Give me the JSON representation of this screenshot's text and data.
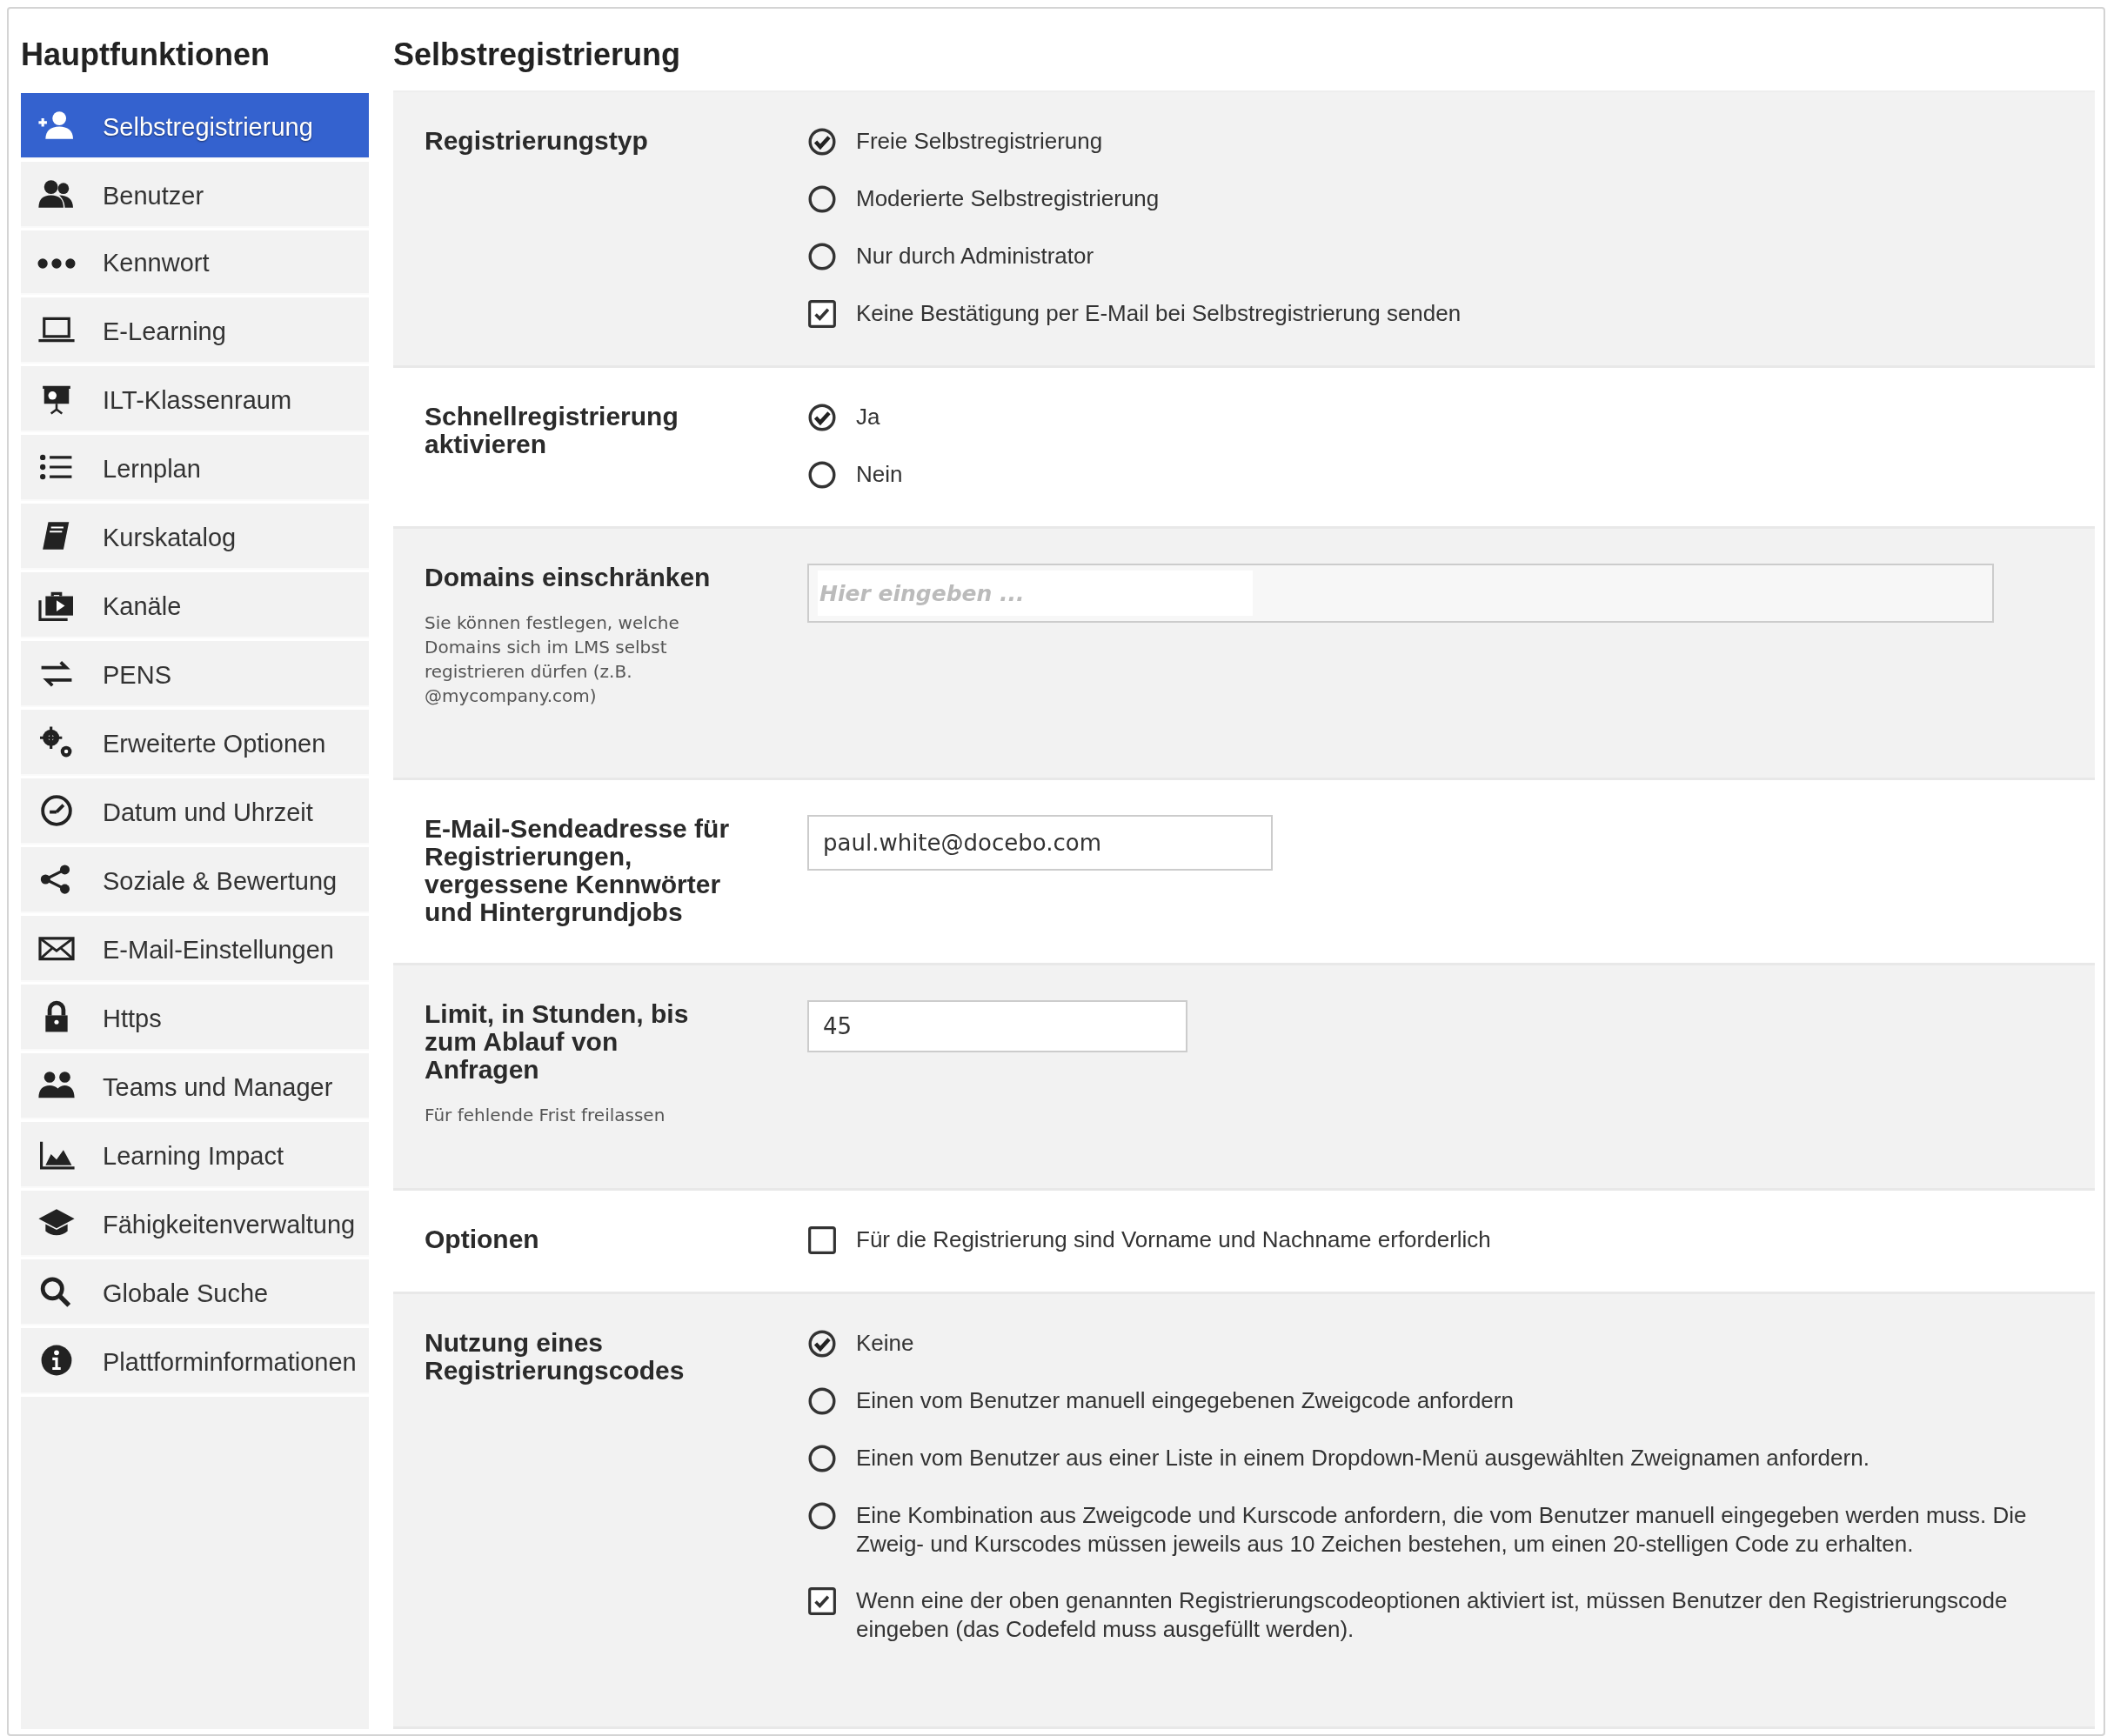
{
  "sidebar": {
    "title": "Hauptfunktionen",
    "items": [
      {
        "label": "Selbstregistrierung",
        "selected": true
      },
      {
        "label": "Benutzer",
        "selected": false
      },
      {
        "label": "Kennwort",
        "selected": false
      },
      {
        "label": "E-Learning",
        "selected": false
      },
      {
        "label": "ILT-Klassenraum",
        "selected": false
      },
      {
        "label": "Lernplan",
        "selected": false
      },
      {
        "label": "Kurskatalog",
        "selected": false
      },
      {
        "label": "Kanäle",
        "selected": false
      },
      {
        "label": "PENS",
        "selected": false
      },
      {
        "label": "Erweiterte Optionen",
        "selected": false
      },
      {
        "label": "Datum und Uhrzeit",
        "selected": false
      },
      {
        "label": "Soziale & Bewertung",
        "selected": false
      },
      {
        "label": "E-Mail-Einstellungen",
        "selected": false
      },
      {
        "label": "Https",
        "selected": false
      },
      {
        "label": "Teams und Manager",
        "selected": false
      },
      {
        "label": "Learning Impact",
        "selected": false
      },
      {
        "label": "Fähigkeitenverwaltung",
        "selected": false
      },
      {
        "label": "Globale Suche",
        "selected": false
      },
      {
        "label": "Plattforminformationen",
        "selected": false
      }
    ]
  },
  "page": {
    "title": "Selbstregistrierung",
    "sections": [
      {
        "label": "Registrierungstyp",
        "controls": [
          {
            "kind": "radio",
            "label": "Freie Selbstregistrierung",
            "selected": true
          },
          {
            "kind": "radio",
            "label": "Moderierte Selbstregistrierung",
            "selected": false
          },
          {
            "kind": "radio",
            "label": "Nur durch Administrator",
            "selected": false
          },
          {
            "kind": "checkbox",
            "label": "Keine Bestätigung per E-Mail bei Selbstregistrierung senden",
            "checked": true
          }
        ]
      },
      {
        "label": "Schnellregistrierung aktivieren",
        "controls": [
          {
            "kind": "radio",
            "label": "Ja",
            "selected": true
          },
          {
            "kind": "radio",
            "label": "Nein",
            "selected": false
          }
        ]
      },
      {
        "label": "Domains einschränken",
        "help": "Sie können festlegen, welche Domains sich im LMS selbst registrieren dürfen (z.B. @mycompany.com)",
        "controls": [
          {
            "kind": "tag-input",
            "placeholder": "Hier eingeben ..."
          }
        ]
      },
      {
        "label": "E-Mail-Sendeadresse für Registrierungen, vergessene Kennwörter und Hintergrundjobs",
        "controls": [
          {
            "kind": "text-input",
            "value": "paul.white@docebo.com"
          }
        ]
      },
      {
        "label": "Limit, in Stunden, bis zum Ablauf von Anfragen",
        "help": "Für fehlende Frist freilassen",
        "controls": [
          {
            "kind": "text-input",
            "value": "45"
          }
        ]
      },
      {
        "label": "Optionen",
        "controls": [
          {
            "kind": "checkbox",
            "label": "Für die Registrierung sind Vorname und Nachname erforderlich",
            "checked": false
          }
        ]
      },
      {
        "label": "Nutzung eines Registrierungscodes",
        "controls": [
          {
            "kind": "radio",
            "label": "Keine",
            "selected": true
          },
          {
            "kind": "radio",
            "label": "Einen vom Benutzer manuell eingegebenen Zweigcode anfordern",
            "selected": false
          },
          {
            "kind": "radio",
            "label": "Einen vom Benutzer aus einer Liste in einem Dropdown-Menü ausgewählten Zweignamen anfordern.",
            "selected": false
          },
          {
            "kind": "radio",
            "label": "Eine Kombination aus Zweigcode und Kurscode anfordern, die vom Benutzer manuell eingegeben werden muss. Die Zweig- und Kurscodes müssen jeweils aus 10 Zeichen bestehen, um einen 20-stelligen Code zu erhalten.",
            "selected": false
          },
          {
            "kind": "checkbox",
            "label": "Wenn eine der oben genannten Registrierungscodeoptionen aktiviert ist, müssen Benutzer den Registrierungscode eingeben (das Codefeld muss ausgefüllt werden).",
            "checked": true
          }
        ]
      }
    ]
  }
}
